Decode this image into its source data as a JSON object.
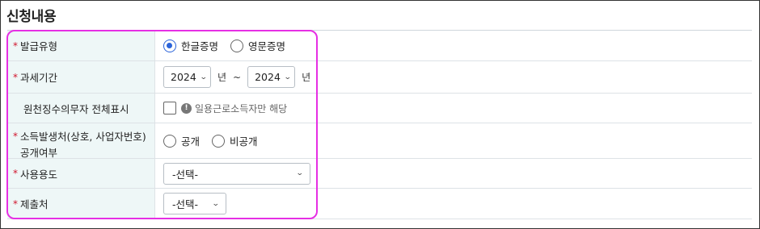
{
  "section": {
    "title": "신청내용"
  },
  "rows": {
    "issue_type": {
      "label": "발급유형",
      "required_mark": "*",
      "options": [
        "한글증명",
        "영문증명"
      ],
      "selected": "한글증명"
    },
    "tax_period": {
      "label": "과세기간",
      "required_mark": "*",
      "from_year": "2024",
      "to_year": "2024",
      "unit": "년",
      "separator": "~"
    },
    "withholding_all": {
      "label": "원천징수의무자 전체표시",
      "checked": false,
      "hint_icon": "exclamation-icon",
      "hint": "일용근로소득자만 해당"
    },
    "income_source": {
      "label_line1": "소득발생처(상호, 사업자번호)",
      "label_line2": "공개여부",
      "required_mark": "*",
      "options": [
        "공개",
        "비공개"
      ],
      "selected": ""
    },
    "usage": {
      "label": "사용용도",
      "required_mark": "*",
      "value": "-선택-"
    },
    "submit_to": {
      "label": "제출처",
      "required_mark": "*",
      "value": "-선택-"
    }
  },
  "colors": {
    "label_bg": "#eef7f7",
    "required": "#d0142c",
    "radio_selected": "#2b63d9",
    "highlight": "#e62fe4"
  }
}
